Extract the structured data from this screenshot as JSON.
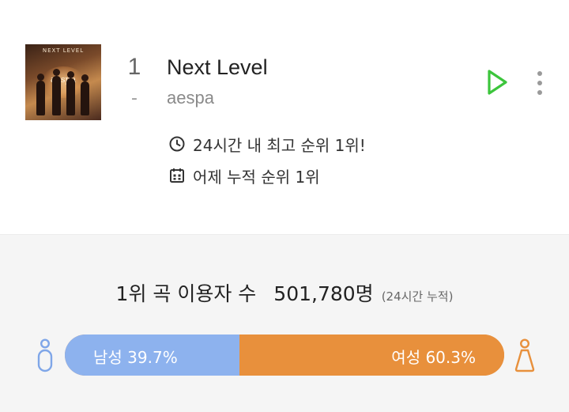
{
  "song": {
    "rank": "1",
    "rank_change": "-",
    "title": "Next Level",
    "artist": "aespa",
    "cover": {
      "title": "NEXT LEVEL",
      "logo": "aespa"
    }
  },
  "info": {
    "peak_text": "24시간 내 최고 순위 1위!",
    "yesterday_text": "어제 누적 순위 1위"
  },
  "icons": {
    "play": "play-icon",
    "more": "more-vertical-icon",
    "clock": "clock-icon",
    "calendar": "calendar-icon",
    "male": "male-person-icon",
    "female": "female-person-icon"
  },
  "stats": {
    "users_label": "1위 곡 이용자 수",
    "users_count": "501,780명",
    "users_note": "(24시간 누적)",
    "male_label": "남성 39.7%",
    "female_label": "여성 60.3%",
    "male_percent": 39.7,
    "female_percent": 60.3
  },
  "colors": {
    "play_green": "#3cc53c",
    "male_blue": "#8db2ee",
    "female_orange": "#e8903c",
    "panel_gray": "#f5f5f5"
  }
}
